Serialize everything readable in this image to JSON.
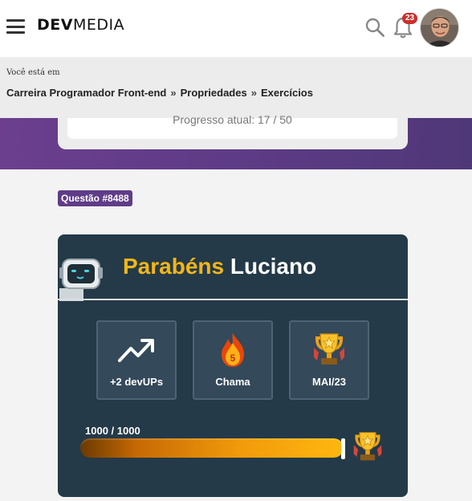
{
  "header": {
    "logo_bold": "DEV",
    "logo_light": "MEDIA",
    "notification_count": "23",
    "icons": [
      "menu-icon",
      "search-icon",
      "bell-icon",
      "avatar"
    ]
  },
  "breadcrumb": {
    "label": "Você está em",
    "items": [
      "Carreira Programador Front-end",
      "Propriedades",
      "Exercícios"
    ],
    "separator": "»"
  },
  "progress": {
    "text": "Progresso atual: 17 / 50"
  },
  "question": {
    "badge": "Questão #8488"
  },
  "result": {
    "title_word": "Parabéns",
    "title_name": "Luciano",
    "stats": [
      {
        "icon": "trending-up-icon",
        "label": "+2 devUPs"
      },
      {
        "icon": "flame-icon",
        "label": "Chama",
        "value": "5"
      },
      {
        "icon": "trophy-icon",
        "label": "MAI/23"
      }
    ],
    "xp": {
      "text": "1000 / 1000",
      "fill_fraction": 1.0
    }
  },
  "colors": {
    "accent_purple": "#5f3c88",
    "card_dark": "#243a48",
    "gold": "#f4b616",
    "badge_red": "#c9302c"
  }
}
